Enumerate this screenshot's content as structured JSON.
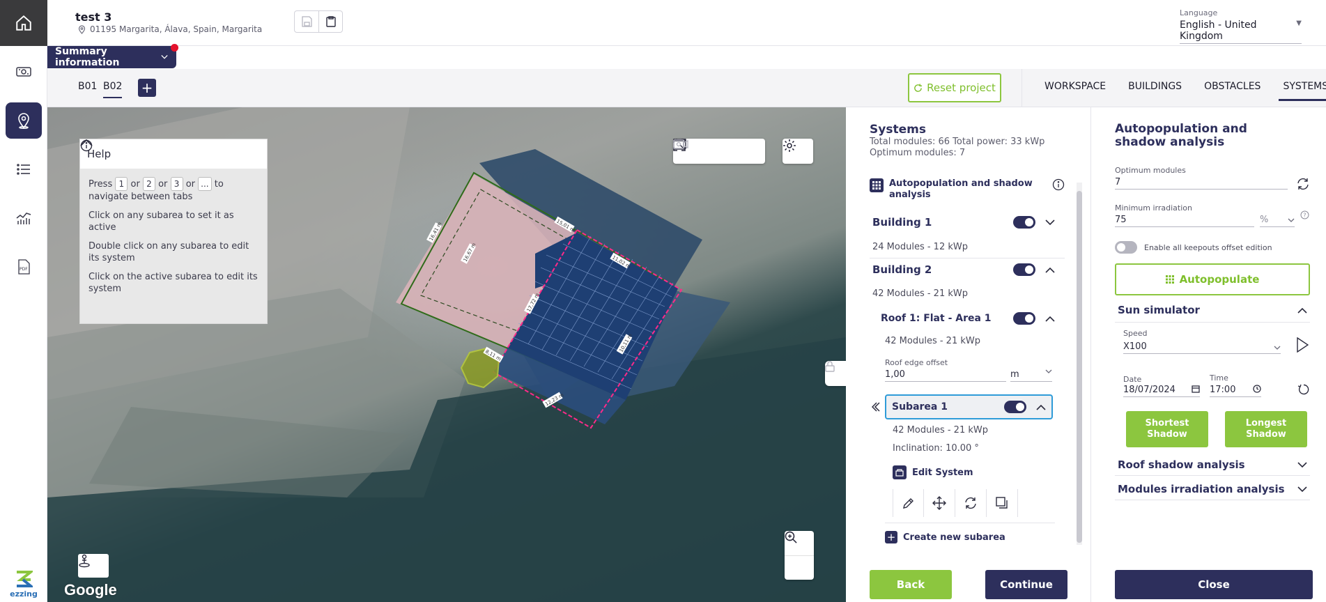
{
  "project": {
    "name": "test 3",
    "address": "01195 Margarita, Álava, Spain, Margarita"
  },
  "language": {
    "label": "Language",
    "value": "English - United Kingdom"
  },
  "summary": {
    "label": "Summary information"
  },
  "building_tabs": [
    {
      "label": "B01"
    },
    {
      "label": "B02"
    }
  ],
  "toolbar": {
    "reset_label": "Reset project"
  },
  "main_tabs": [
    {
      "label": "WORKSPACE"
    },
    {
      "label": "BUILDINGS"
    },
    {
      "label": "OBSTACLES"
    },
    {
      "label": "SYSTEMS"
    }
  ],
  "map": {
    "dimension_labels": [
      "16,41 m",
      "15,01 m",
      "11,02 m",
      "17,72 m",
      "10,11 m",
      "8,11 m",
      "12,23 m",
      "16,67 m"
    ],
    "google_label": "Google"
  },
  "help": {
    "title": "Help",
    "press": "Press",
    "or": "or",
    "keys": [
      "1",
      "2",
      "3",
      "..."
    ],
    "to": "to",
    "nav_tail": "navigate between tabs",
    "line2": "Click on any subarea to set it as active",
    "line3": "Double click on any subarea to edit its system",
    "line4": "Click on the active subarea to edit its system"
  },
  "systems": {
    "title": "Systems",
    "totals": "Total modules: 66 Total power: 33 kWp",
    "optimum": "Optimum modules: 7",
    "autopop_label": "Autopopulation and shadow analysis",
    "building1": {
      "label": "Building 1",
      "summary": "24 Modules - 12 kWp"
    },
    "building2": {
      "label": "Building 2",
      "summary": "42 Modules - 21 kWp"
    },
    "roof1": {
      "label": "Roof 1: Flat - Area 1",
      "summary": "42 Modules - 21 kWp",
      "offset_label": "Roof edge offset",
      "offset_value": "1,00",
      "offset_unit": "m"
    },
    "subarea1": {
      "label": "Subarea 1",
      "summary": "42 Modules - 21 kWp",
      "inclination": "Inclination: 10.00 °"
    },
    "edit_system": "Edit System",
    "create_subarea": "Create new subarea",
    "back": "Back",
    "continue": "Continue"
  },
  "autopop_panel": {
    "title": "Autopopulation and shadow analysis",
    "optimum_label": "Optimum modules",
    "optimum_value": "7",
    "min_irr_label": "Minimum irradiation",
    "min_irr_value": "75",
    "min_irr_unit": "%",
    "keepouts_label": "Enable all keepouts offset edition",
    "autopopulate": "Autopopulate",
    "sun_simulator": "Sun simulator",
    "speed_label": "Speed",
    "speed_value": "X100",
    "date_label": "Date",
    "date_value": "18/07/2024",
    "time_label": "Time",
    "time_value": "17:00",
    "shortest": "Shortest Shadow",
    "longest": "Longest Shadow",
    "roof_shadow": "Roof shadow analysis",
    "modules_irr": "Modules irradiation analysis",
    "close": "Close"
  },
  "colors": {
    "navy": "#2d2f5c",
    "green": "#8cc63f",
    "active_border": "#2e9bd8",
    "alert": "#e4122c"
  }
}
